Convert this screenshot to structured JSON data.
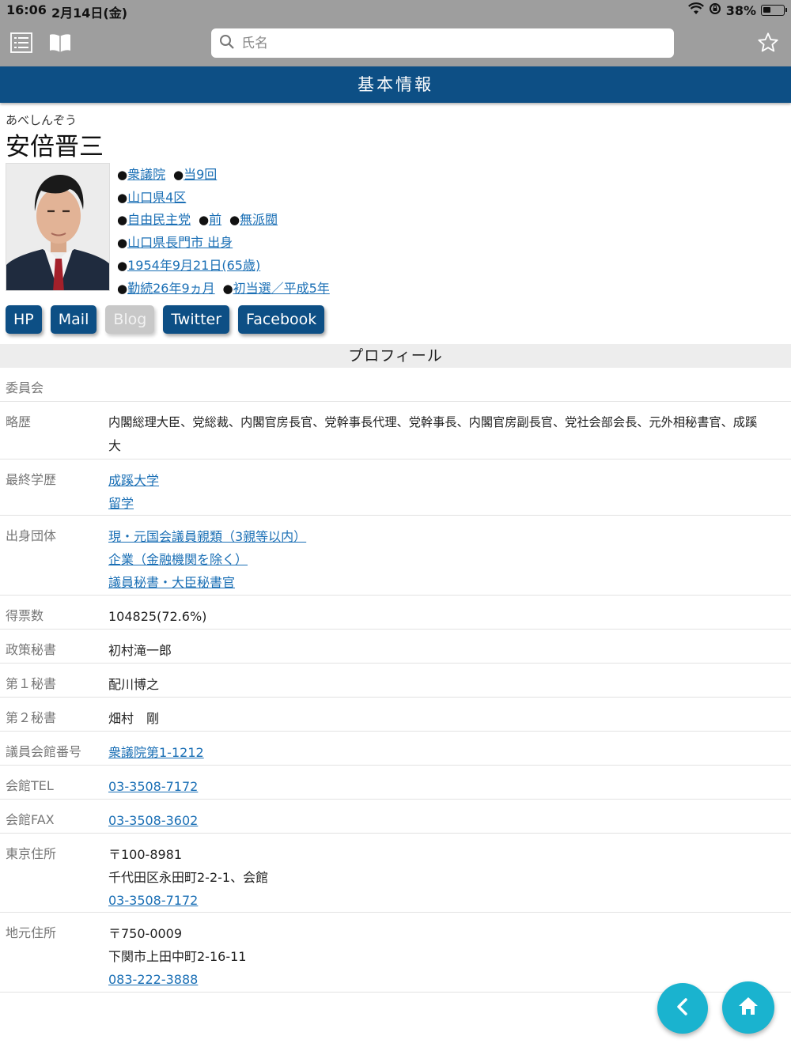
{
  "status": {
    "time": "16:06",
    "date": "2月14日(金)",
    "battery": "38%",
    "battery_fraction": 0.38
  },
  "search": {
    "placeholder": "氏名"
  },
  "header": {
    "title": "基本情報"
  },
  "member": {
    "kana": "あべしんぞう",
    "name": "安倍晋三",
    "house": "衆議院",
    "terms": "当9回",
    "district": "山口県4区",
    "party": "自由民主党",
    "status": "前",
    "faction": "無派閥",
    "birthplace": "山口県長門市 出身",
    "birthdate": "1954年9月21日(65歳)",
    "service": "勤続26年9ヵ月",
    "first_elected": "初当選／平成5年"
  },
  "buttons": {
    "hp": "HP",
    "mail": "Mail",
    "blog": "Blog",
    "twitter": "Twitter",
    "facebook": "Facebook"
  },
  "profile": {
    "title": "プロフィール",
    "committee_label": "委員会",
    "career_label": "略歴",
    "career_line1": "内閣総理大臣、党総裁、内閣官房長官、党幹事長代理、党幹事長、内閣官房副長官、党社会部会長、元外相秘書官、成蹊",
    "career_line2": "大",
    "education_label": "最終学歴",
    "education": [
      "成蹊大学",
      "留学"
    ],
    "origin_label": "出身団体",
    "origin": [
      "現・元国会議員親類（3親等以内）",
      "企業（金融機関を除く）",
      "議員秘書・大臣秘書官"
    ],
    "votes_label": "得票数",
    "votes": "104825(72.6%)",
    "policy_secretary_label": "政策秘書",
    "policy_secretary": "初村滝一郎",
    "secretary1_label": "第１秘書",
    "secretary1": "配川博之",
    "secretary2_label": "第２秘書",
    "secretary2": "畑村　剛",
    "office_label": "議員会館番号",
    "office": "衆議院第1-1212",
    "tel_label": "会館TEL",
    "tel": "03-3508-7172",
    "fax_label": "会館FAX",
    "fax": "03-3508-3602",
    "tokyo_label": "東京住所",
    "tokyo_zip": "〒100-8981",
    "tokyo_address": "千代田区永田町2-2-1、会館",
    "tokyo_tel": "03-3508-7172",
    "local_label": "地元住所",
    "local_zip": "〒750-0009",
    "local_address": "下関市上田中町2-16-11",
    "local_tel": "083-222-3888"
  }
}
